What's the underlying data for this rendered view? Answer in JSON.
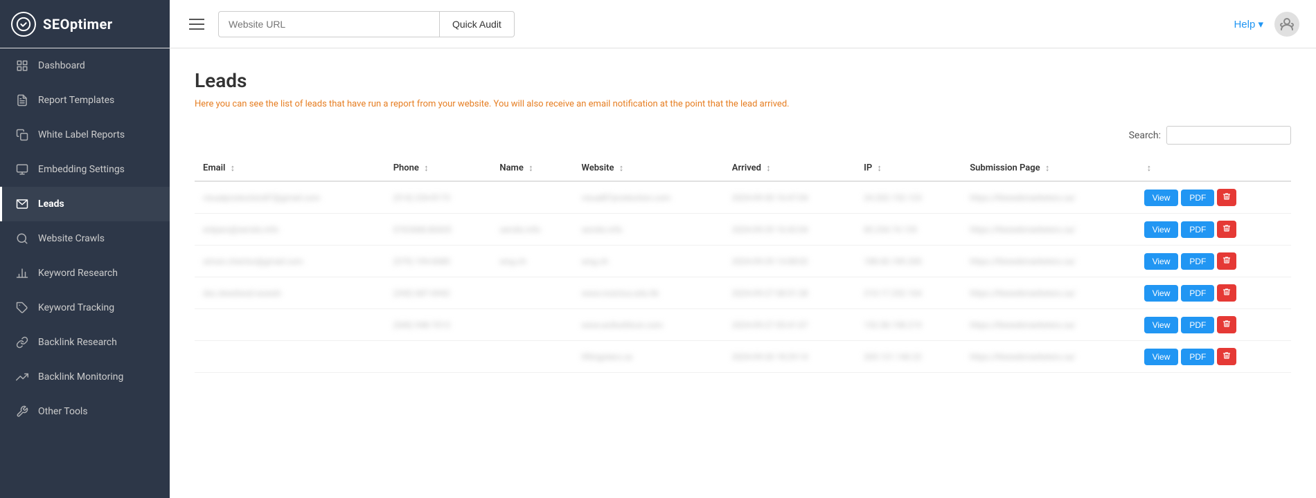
{
  "topbar": {
    "logo_text": "SEOptimer",
    "url_placeholder": "Website URL",
    "quick_audit_label": "Quick Audit",
    "help_label": "Help ▾"
  },
  "sidebar": {
    "items": [
      {
        "id": "dashboard",
        "label": "Dashboard",
        "icon": "grid-icon",
        "active": false
      },
      {
        "id": "report-templates",
        "label": "Report Templates",
        "icon": "file-icon",
        "active": false
      },
      {
        "id": "white-label-reports",
        "label": "White Label Reports",
        "icon": "copy-icon",
        "active": false
      },
      {
        "id": "embedding-settings",
        "label": "Embedding Settings",
        "icon": "monitor-icon",
        "active": false
      },
      {
        "id": "leads",
        "label": "Leads",
        "icon": "mail-icon",
        "active": true
      },
      {
        "id": "website-crawls",
        "label": "Website Crawls",
        "icon": "search-icon",
        "active": false
      },
      {
        "id": "keyword-research",
        "label": "Keyword Research",
        "icon": "bar-chart-icon",
        "active": false
      },
      {
        "id": "keyword-tracking",
        "label": "Keyword Tracking",
        "icon": "tag-icon",
        "active": false
      },
      {
        "id": "backlink-research",
        "label": "Backlink Research",
        "icon": "link-icon",
        "active": false
      },
      {
        "id": "backlink-monitoring",
        "label": "Backlink Monitoring",
        "icon": "trending-icon",
        "active": false
      },
      {
        "id": "other-tools",
        "label": "Other Tools",
        "icon": "tool-icon",
        "active": false
      }
    ]
  },
  "page": {
    "title": "Leads",
    "subtitle": "Here you can see the list of leads that have run a report from your website. You will also receive an email notification at the point that the lead arrived.",
    "search_label": "Search:",
    "search_placeholder": ""
  },
  "table": {
    "columns": [
      {
        "id": "email",
        "label": "Email",
        "sortable": true
      },
      {
        "id": "phone",
        "label": "Phone",
        "sortable": true
      },
      {
        "id": "name",
        "label": "Name",
        "sortable": true
      },
      {
        "id": "website",
        "label": "Website",
        "sortable": true
      },
      {
        "id": "arrived",
        "label": "Arrived",
        "sortable": true
      },
      {
        "id": "ip",
        "label": "IP",
        "sortable": true
      },
      {
        "id": "submission_page",
        "label": "Submission Page",
        "sortable": true
      },
      {
        "id": "actions",
        "label": "",
        "sortable": true
      }
    ],
    "rows": [
      {
        "email": "visualproduction87@gmail.com",
        "phone": "(514) 234-8173",
        "name": "",
        "website": "visual87production.com",
        "arrived": "2024-09-30\n16:47:04",
        "ip": "24.202.152.123",
        "submission_page": "https://thewebmarketers.ca/"
      },
      {
        "email": "enlpars@serolis.info",
        "phone": "0763468.80435",
        "name": "serolis.info",
        "website": "serolis.info",
        "arrived": "2024-09-29\n16:42:04",
        "ip": "85.254.74.135",
        "submission_page": "https://thewebmarketers.ca/"
      },
      {
        "email": "simon.charton@gmail.com",
        "phone": "(579) 194-6680",
        "name": "wng.ch",
        "website": "wng.ch",
        "arrived": "2024-09-29\n13:08:02",
        "ip": "188.60.189.200",
        "submission_page": "https://thewebmarketers.ca/"
      },
      {
        "email": "dsc.dwedwsd.wswdv",
        "phone": "(345) 687-6942",
        "name": "",
        "website": "www.moictus.edu.hk",
        "arrived": "2024-09-27\n08:51:28",
        "ip": "210.17.252.164",
        "submission_page": "https://thewebmarketers.ca/"
      },
      {
        "email": "",
        "phone": "(540) 948-7013",
        "name": "",
        "website": "www.acibuildcon.com",
        "arrived": "2024-09-27\n05:41:07",
        "ip": "152.58.198.219",
        "submission_page": "https://thewebmarketers.ca/"
      },
      {
        "email": "",
        "phone": "",
        "name": "",
        "website": "liftingstars.ca",
        "arrived": "2024-09-26\n18:29:14",
        "ip": "205.121.140.22",
        "submission_page": "https://thewebmarketers.ca/"
      }
    ],
    "btn_view": "View",
    "btn_pdf": "PDF"
  }
}
